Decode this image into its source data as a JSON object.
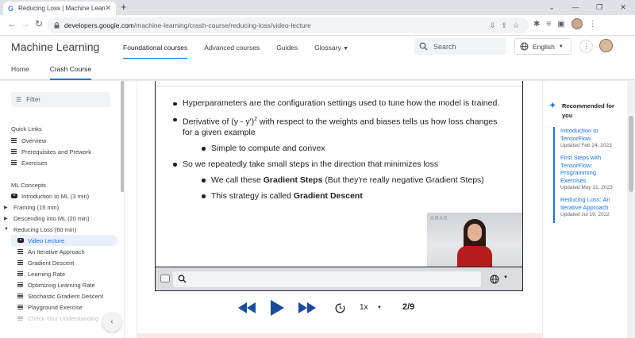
{
  "browser": {
    "tab_title": "Reducing Loss  |  Machine Learning",
    "tab_favicon": "G",
    "url_host": "developers.google.com",
    "url_path": "/machine-learning/crash-course/reducing-loss/video-lecture"
  },
  "header": {
    "brand": "Machine Learning",
    "nav": [
      "Foundational courses",
      "Advanced courses",
      "Guides",
      "Glossary"
    ],
    "search_placeholder": "Search",
    "language": "English"
  },
  "subnav": [
    "Home",
    "Crash Course"
  ],
  "sidebar": {
    "filter_placeholder": "Filter",
    "quick_links_heading": "Quick Links",
    "quick_links": [
      "Overview",
      "Prerequisites and Prework",
      "Exercises"
    ],
    "ml_concepts_heading": "ML Concepts",
    "intro": "Introduction to ML (3 min)",
    "framing": "Framing (15 min)",
    "descending": "Descending into ML (20 min)",
    "reducing": "Reducing Loss (60 min)",
    "reducing_children": [
      "Video Lecture",
      "An Iterative Approach",
      "Gradient Descent",
      "Learning Rate",
      "Optimizing Learning Rate",
      "Stochastic Gradient Descent",
      "Playground Exercise",
      "Check Your Understanding"
    ]
  },
  "slide": {
    "b1": "Hyperparameters are the configuration settings used to tune how the model is trained.",
    "b2_pre": "Derivative of (y - y')",
    "b2_sup": "2",
    "b2_post": " with respect to the weights and biases tells us how loss changes for a given example",
    "b2_sub": "Simple to compute and convex",
    "b3": "So we repeatedly take small steps in the direction that minimizes loss",
    "b3a_pre": "We call these ",
    "b3a_bold": "Gradient Steps",
    "b3a_post": " (But they're really negative Gradient Steps)",
    "b3b_pre": "This strategy is called ",
    "b3b_bold": "Gradient Descent",
    "video_bg_text": "ABAB"
  },
  "player": {
    "speed": "1x",
    "page": "2/9"
  },
  "recommended": {
    "heading": "Recommended for you",
    "items": [
      {
        "title": "Introduction to TensorFlow",
        "date": "Updated Feb 24, 2023"
      },
      {
        "title": "First Steps with TensorFlow: Programming Exercises",
        "date": "Updated May 31, 2023"
      },
      {
        "title": "Reducing Loss: An Iterative Approach",
        "date": "Updated Jul 19, 2022"
      }
    ]
  },
  "colors": {
    "accent": "#1a73e8",
    "player_icons": "#1a4c9e"
  }
}
